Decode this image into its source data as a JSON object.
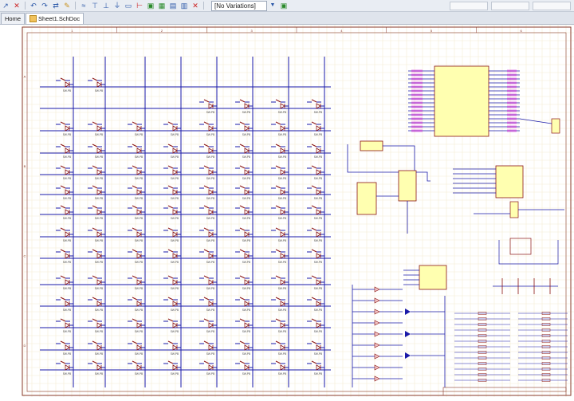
{
  "toolbar": {
    "variations_label": "[No Variations]",
    "icons": [
      "wire-icon",
      "bus-icon",
      "net-label-icon",
      "power-port-icon",
      "gnd-icon",
      "part-icon",
      "undo-icon",
      "redo-icon",
      "cross-probe-icon",
      "delete-icon"
    ]
  },
  "tabs": [
    {
      "label": "Home",
      "active": false
    },
    {
      "label": "Sheet1.SchDoc",
      "active": true
    }
  ],
  "sheet": {
    "border_color": "#8a3a2a",
    "wire_color": "#1a1aa8",
    "grid_color": "#f3ecd2",
    "part_color": "#8a1414",
    "ic_fill": "#ffffb0",
    "switch_label": "SW-PB",
    "ic_u2_label": "U1",
    "col_letters": [
      "1",
      "2",
      "3",
      "4",
      "5",
      "6"
    ],
    "row_letters": [
      "A",
      "B",
      "C",
      "D"
    ]
  }
}
